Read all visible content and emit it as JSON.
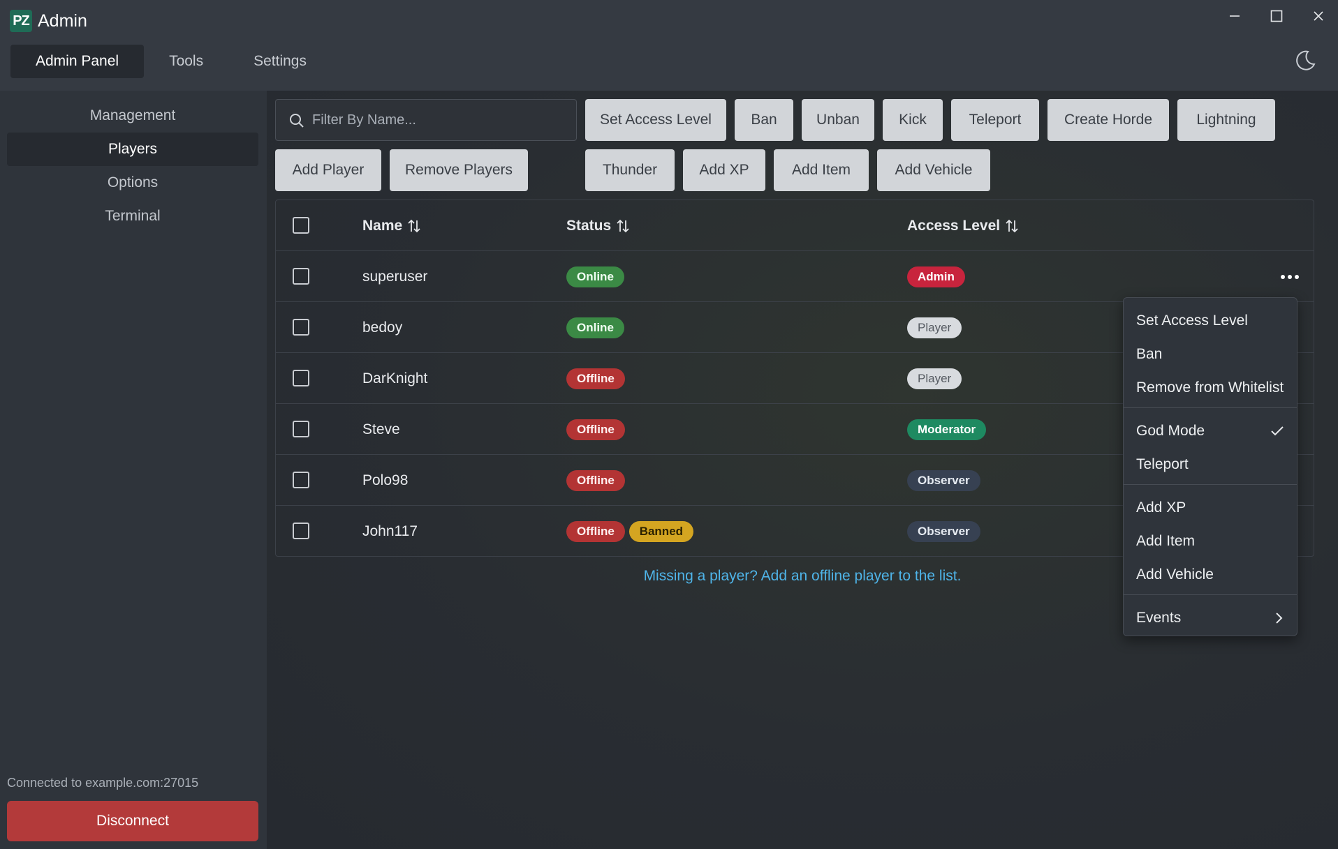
{
  "app": {
    "logo_text": "PZ",
    "title": "Admin"
  },
  "top_tabs": [
    {
      "label": "Admin Panel",
      "active": true
    },
    {
      "label": "Tools",
      "active": false
    },
    {
      "label": "Settings",
      "active": false
    }
  ],
  "sidebar": {
    "items": [
      {
        "label": "Management"
      },
      {
        "label": "Players",
        "active": true
      },
      {
        "label": "Options"
      },
      {
        "label": "Terminal"
      }
    ],
    "connection_text": "Connected to example.com:27015",
    "disconnect_label": "Disconnect"
  },
  "search": {
    "placeholder": "Filter By Name..."
  },
  "actions": {
    "set_access_level": "Set Access Level",
    "ban": "Ban",
    "unban": "Unban",
    "kick": "Kick",
    "teleport": "Teleport",
    "create_horde": "Create Horde",
    "lightning": "Lightning",
    "add_player": "Add Player",
    "remove_players": "Remove Players",
    "thunder": "Thunder",
    "add_xp": "Add XP",
    "add_item": "Add Item",
    "add_vehicle": "Add Vehicle"
  },
  "table": {
    "headers": {
      "name": "Name",
      "status": "Status",
      "access_level": "Access Level"
    },
    "rows": [
      {
        "name": "superuser",
        "status": "Online",
        "access": "Admin"
      },
      {
        "name": "bedoy",
        "status": "Online",
        "access": "Player"
      },
      {
        "name": "DarKnight",
        "status": "Offline",
        "access": "Player"
      },
      {
        "name": "Steve",
        "status": "Offline",
        "access": "Moderator"
      },
      {
        "name": "Polo98",
        "status": "Offline",
        "access": "Observer"
      },
      {
        "name": "John117",
        "status": "Offline",
        "extra_badge": "Banned",
        "access": "Observer"
      }
    ]
  },
  "footer_link": "Missing a player? Add an offline player to the list.",
  "context_menu": {
    "items": [
      {
        "label": "Set Access Level"
      },
      {
        "label": "Ban"
      },
      {
        "label": "Remove from Whitelist"
      },
      {
        "label": "God Mode",
        "checked": true
      },
      {
        "label": "Teleport"
      },
      {
        "label": "Add XP"
      },
      {
        "label": "Add Item"
      },
      {
        "label": "Add Vehicle"
      },
      {
        "label": "Events",
        "submenu": true
      }
    ]
  },
  "colors": {
    "online": "#3b8a45",
    "offline": "#b33434",
    "banned": "#d4a521",
    "admin": "#c8243d",
    "moderator": "#1e8a61",
    "observer": "#374152",
    "disconnect": "#b33a3a",
    "link": "#4fb4e8"
  }
}
